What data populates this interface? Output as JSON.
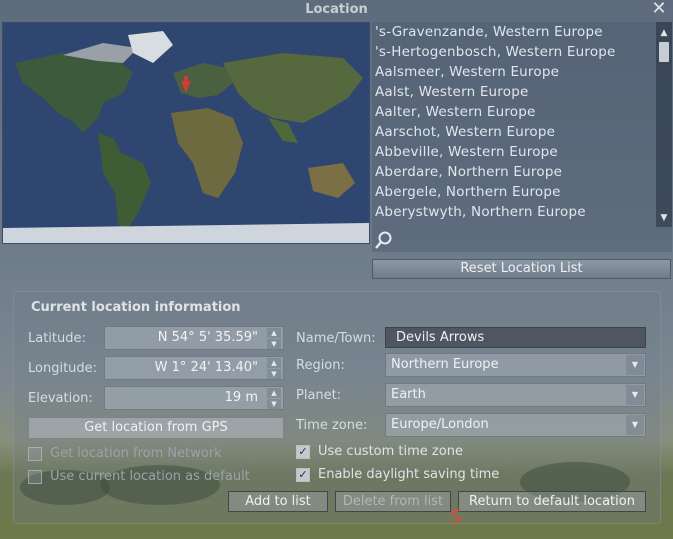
{
  "window": {
    "title": "Location"
  },
  "city_list": {
    "items": [
      "'s-Gravenzande, Western Europe",
      "'s-Hertogenbosch, Western Europe",
      "Aalsmeer, Western Europe",
      "Aalst, Western Europe",
      "Aalter, Western Europe",
      "Aarschot, Western Europe",
      "Abbeville, Western Europe",
      "Aberdare, Northern Europe",
      "Abergele, Northern Europe",
      "Aberystwyth, Northern Europe"
    ]
  },
  "reset_button": "Reset Location List",
  "info": {
    "title": "Current location information",
    "latitude_label": "Latitude:",
    "latitude_value": "N 54° 5' 35.59\"",
    "longitude_label": "Longitude:",
    "longitude_value": "W 1° 24' 13.40\"",
    "elevation_label": "Elevation:",
    "elevation_value": "19 m",
    "gps_button": "Get location from GPS",
    "network_checkbox": "Get location from Network",
    "default_checkbox": "Use current location as default",
    "name_label": "Name/Town:",
    "name_value": "Devils Arrows",
    "region_label": "Region:",
    "region_value": "Northern Europe",
    "planet_label": "Planet:",
    "planet_value": "Earth",
    "timezone_label": "Time zone:",
    "timezone_value": "Europe/London",
    "custom_tz_checkbox": "Use custom time zone",
    "dst_checkbox": "Enable daylight saving time"
  },
  "actions": {
    "add": "Add to list",
    "delete": "Delete from list",
    "return": "Return to default location"
  },
  "overlay_marker": "S",
  "colors": {
    "accent_marker": "#e04a3a",
    "map_ocean": "#2f4670"
  }
}
